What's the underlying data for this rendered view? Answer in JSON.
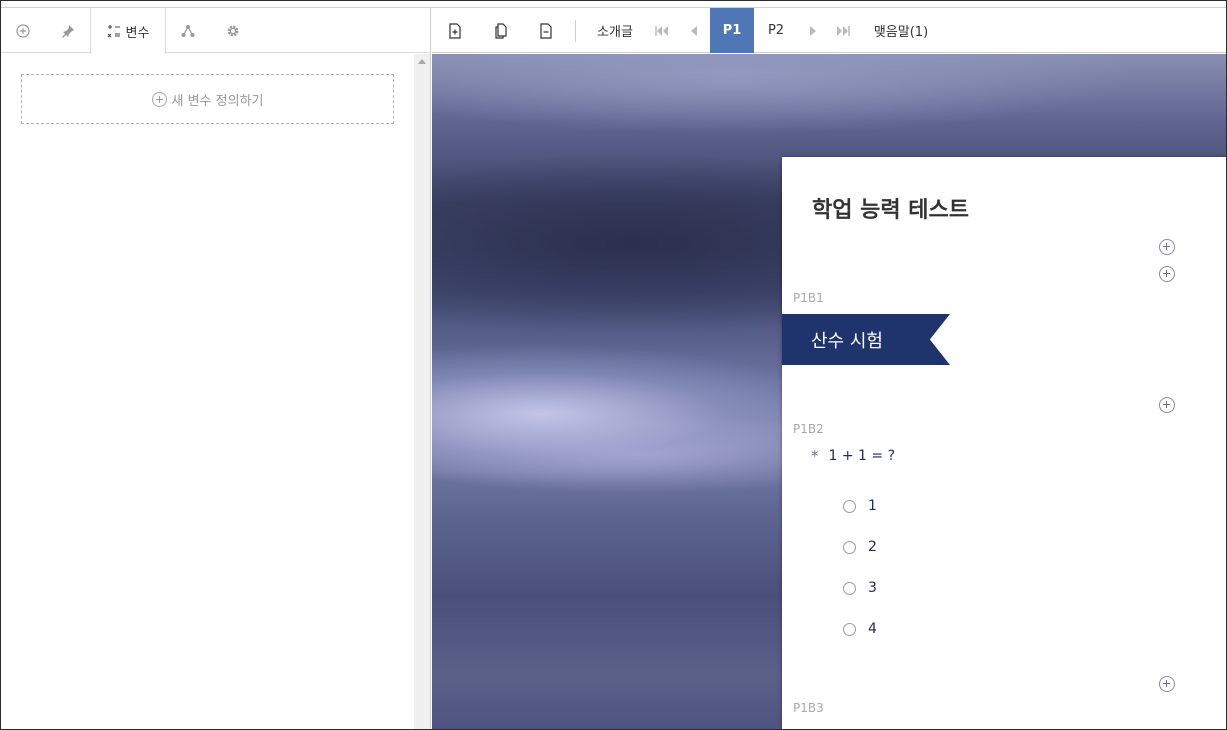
{
  "left_panel": {
    "tabs": [
      {
        "name": "add",
        "icon": "plus-circle-icon",
        "label": ""
      },
      {
        "name": "pin",
        "icon": "pin-icon",
        "label": ""
      },
      {
        "name": "variables",
        "icon": "variables-icon",
        "label": "변수"
      },
      {
        "name": "branch",
        "icon": "branch-icon",
        "label": ""
      },
      {
        "name": "settings",
        "icon": "gear-icon",
        "label": ""
      }
    ],
    "new_variable_button": "새 변수 정의하기"
  },
  "toolbar": {
    "add_page_icon": "add-page-icon",
    "copy_page_icon": "copy-page-icon",
    "delete_page_icon": "delete-page-icon",
    "intro_label": "소개글",
    "pages": [
      "P1",
      "P2"
    ],
    "active_page": "P1",
    "outro_label": "맺음말(1)"
  },
  "card": {
    "title": "학업 능력 테스트",
    "blocks": [
      {
        "id": "P1B1",
        "label": "산수 시험"
      },
      {
        "id": "P1B2",
        "required_mark": "*",
        "question": "1 + 1 = ?",
        "options": [
          "1",
          "2",
          "3",
          "4"
        ]
      },
      {
        "id": "P1B3"
      }
    ]
  },
  "colors": {
    "accent": "#4f77b5",
    "ribbon": "#1f346c",
    "question_text": "#1f2a5e"
  }
}
